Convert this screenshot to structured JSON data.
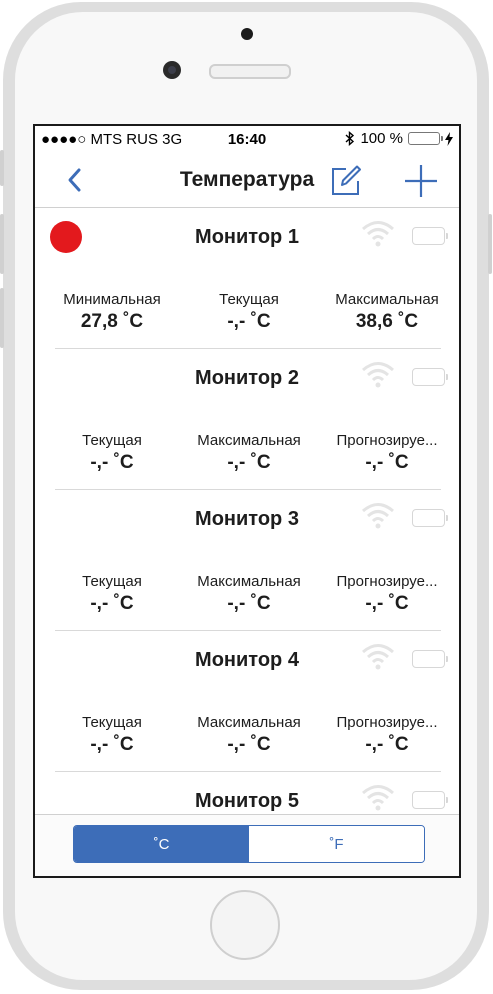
{
  "status_bar": {
    "carrier": "●●●●○ MTS RUS  3G",
    "time": "16:40",
    "bluetooth_icon": "bluetooth-icon",
    "battery_percent": "100 %",
    "battery_level": 1.0,
    "charging_icon": "bolt-icon"
  },
  "navbar": {
    "title": "Температура",
    "back_icon": "chevron-left-icon",
    "edit_icon": "compose-icon",
    "add_icon": "plus-icon"
  },
  "colors": {
    "accent": "#3d6db8",
    "alert": "#e3191d",
    "battery_green": "#4cd964"
  },
  "monitors": [
    {
      "name": "Монитор 1",
      "alert": true,
      "metrics": [
        {
          "label": "Минимальная",
          "value": "27,8 ˚C"
        },
        {
          "label": "Текущая",
          "value": "-,- ˚C"
        },
        {
          "label": "Максимальная",
          "value": "38,6 ˚C"
        }
      ]
    },
    {
      "name": "Монитор 2",
      "alert": false,
      "metrics": [
        {
          "label": "Текущая",
          "value": "-,- ˚C"
        },
        {
          "label": "Максимальная",
          "value": "-,- ˚C"
        },
        {
          "label": "Прогнозируе...",
          "value": "-,- ˚C"
        }
      ]
    },
    {
      "name": "Монитор 3",
      "alert": false,
      "metrics": [
        {
          "label": "Текущая",
          "value": "-,- ˚C"
        },
        {
          "label": "Максимальная",
          "value": "-,- ˚C"
        },
        {
          "label": "Прогнозируе...",
          "value": "-,- ˚C"
        }
      ]
    },
    {
      "name": "Монитор 4",
      "alert": false,
      "metrics": [
        {
          "label": "Текущая",
          "value": "-,- ˚C"
        },
        {
          "label": "Максимальная",
          "value": "-,- ˚C"
        },
        {
          "label": "Прогнозируе...",
          "value": "-,- ˚C"
        }
      ]
    },
    {
      "name": "Монитор 5",
      "alert": false,
      "metrics": []
    }
  ],
  "unit_toggle": {
    "celsius": "˚C",
    "fahrenheit": "˚F",
    "selected": "celsius"
  }
}
